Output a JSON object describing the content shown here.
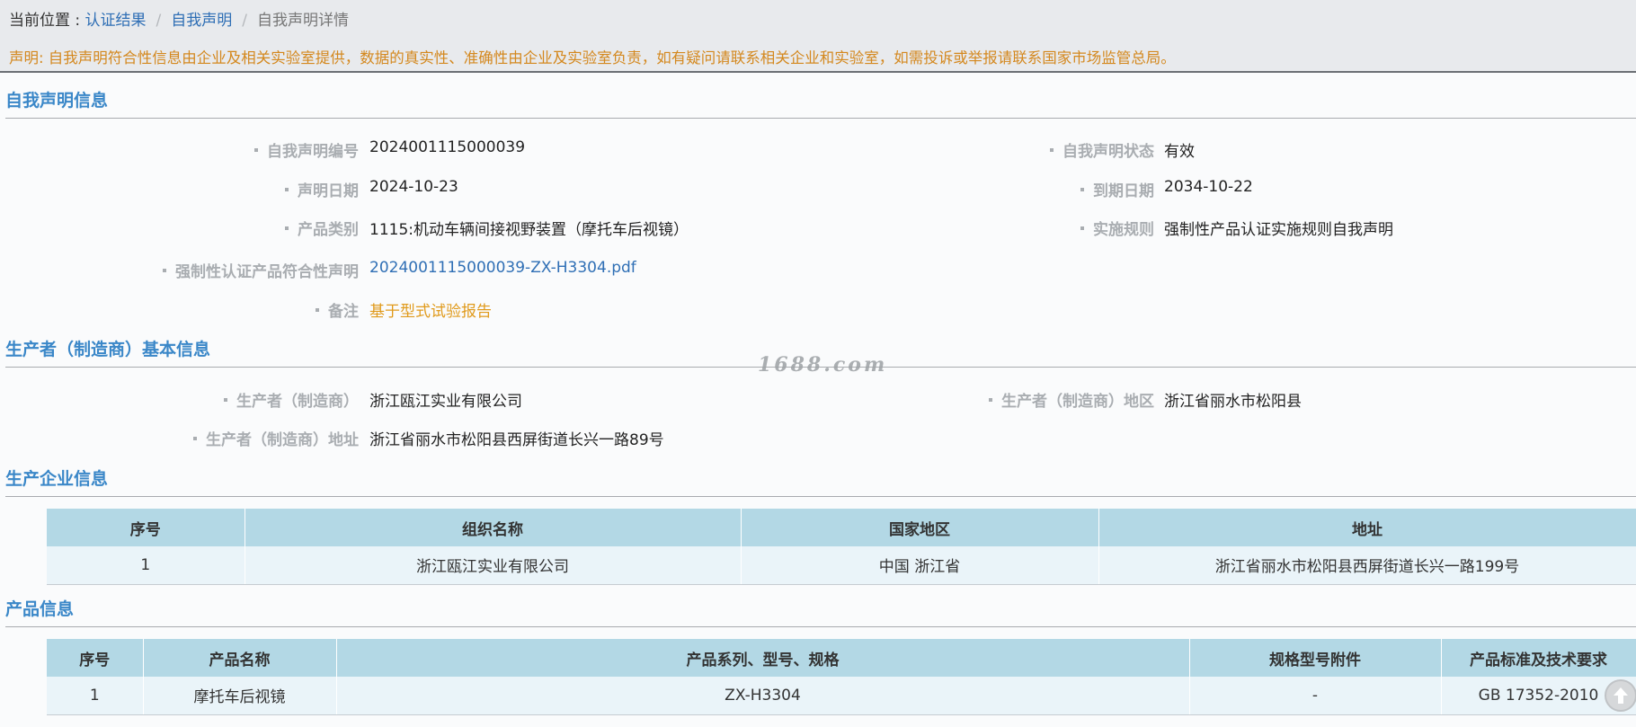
{
  "breadcrumb": {
    "prefix": "当前位置 : ",
    "items": [
      "认证结果",
      "自我声明",
      "自我声明详情"
    ]
  },
  "notice": "声明: 自我声明符合性信息由企业及相关实验室提供，数据的真实性、准确性由企业及实验室负责，如有疑问请联系相关企业和实验室，如需投诉或举报请联系国家市场监管总局。",
  "sections": {
    "declaration": "自我声明信息",
    "producer": "生产者（制造商）基本信息",
    "manufacturer": "生产企业信息",
    "product": "产品信息"
  },
  "declaration": {
    "number_label": "自我声明编号",
    "number": "2024001115000039",
    "status_label": "自我声明状态",
    "status": "有效",
    "date_label": "声明日期",
    "date": "2024-10-23",
    "expiry_label": "到期日期",
    "expiry": "2034-10-22",
    "category_label": "产品类别",
    "category": "1115:机动车辆间接视野装置（摩托车后视镜）",
    "rule_label": "实施规则",
    "rule": "强制性产品认证实施规则自我声明",
    "file_label": "强制性认证产品符合性声明",
    "file": "2024001115000039-ZX-H3304.pdf",
    "remark_label": "备注",
    "remark": "基于型式试验报告"
  },
  "producer": {
    "name_label": "生产者（制造商）",
    "name": "浙江瓯江实业有限公司",
    "region_label": "生产者（制造商）地区",
    "region": "浙江省丽水市松阳县",
    "address_label": "生产者（制造商）地址",
    "address": "浙江省丽水市松阳县西屏街道长兴一路89号"
  },
  "manufacturer_table": {
    "headers": [
      "序号",
      "组织名称",
      "国家地区",
      "地址"
    ],
    "rows": [
      [
        "1",
        "浙江瓯江实业有限公司",
        "中国 浙江省",
        "浙江省丽水市松阳县西屏街道长兴一路199号"
      ]
    ]
  },
  "product_table": {
    "headers": [
      "序号",
      "产品名称",
      "产品系列、型号、规格",
      "规格型号附件",
      "产品标准及技术要求"
    ],
    "rows": [
      [
        "1",
        "摩托车后视镜",
        "ZX-H3304",
        "-",
        "GB 17352-2010"
      ]
    ]
  },
  "watermark": "1688.com",
  "icons": {
    "scroll_top": "arrow-up-circle-icon"
  }
}
